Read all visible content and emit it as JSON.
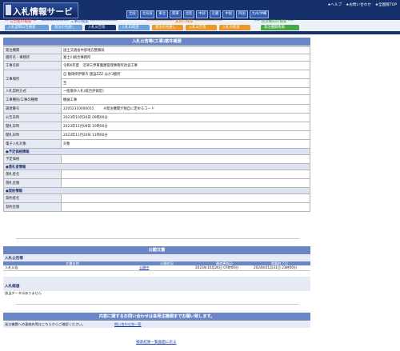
{
  "header": {
    "logo_text": "入札情報サービス",
    "links": [
      "★ヘルプ",
      "★お問い合わせ",
      "★全国版TOP"
    ],
    "regions": [
      "全国",
      "北海道",
      "東北",
      "関東",
      "北陸",
      "中部",
      "近畿",
      "中国",
      "四国",
      "九州/沖縄"
    ]
  },
  "subnav": {
    "items": [
      "** 公告能の検索 **",
      "*************** 工事の検索 ***************",
      "*************** 業務の検索 ***************",
      "*** 発注機関の検索 ***"
    ],
    "colors": [
      "#e23a3a",
      "#3a5fc0",
      "#d97a16",
      "#3c9a3c"
    ]
  },
  "tabs": [
    {
      "label": "入札説明公告検索",
      "color": "#6aa0dc"
    },
    {
      "label": "発注の見通し",
      "color": "#6aa0dc"
    },
    {
      "label": "入札公告等",
      "color": "#15306a"
    },
    {
      "label": "入札の経過",
      "color": "#6aa0dc"
    },
    {
      "label": "発注の見通し",
      "color": "#e79a2c"
    },
    {
      "label": "入札公告等",
      "color": "#e79a2c"
    },
    {
      "label": "入札の経過",
      "color": "#e79a2c"
    },
    {
      "label": "発注機関情報",
      "color": "#4aa84a"
    }
  ],
  "main": {
    "title": "入札公告等(工事)案件概要",
    "rows": [
      {
        "key": "発注機関",
        "value": "国土交通省中部地方整備局"
      },
      {
        "key": "箇所名・事務所",
        "value": "富士川統合事務所"
      },
      {
        "key": "工事名称",
        "value": "令和6年度　沼津三伊東農業管理事務所改良工事"
      },
      {
        "key": "工事場所",
        "value": "自 静岡県伊東市 建設ZZZ ほか3箇所"
      },
      {
        "key": "",
        "value": "至"
      },
      {
        "key": "入札契約方式",
        "value": "一般競争入札(総合評価型)"
      },
      {
        "key": "工事種別/工事の種類",
        "value": "機械工事"
      },
      {
        "key": "調達番号",
        "value": "22052310000015",
        "extra": "※発注機関が独自に定めるコード"
      },
      {
        "key": "公告日時",
        "value": "2023年10月26日 09時00分"
      },
      {
        "key": "開札日時",
        "value": "2023年11月09日 10時00分"
      },
      {
        "key": "開札日時",
        "value": "2023年11月20日 11時00分"
      },
      {
        "key": "電子入札対象",
        "value": "対象"
      }
    ],
    "sections": [
      {
        "title": "●予定価格情報",
        "rows": [
          {
            "key": "予定価格",
            "value": ""
          }
        ]
      },
      {
        "title": "●落札者情報",
        "rows": [
          {
            "key": "落札者名",
            "value": ""
          },
          {
            "key": "落札金額",
            "value": ""
          }
        ]
      },
      {
        "title": "●契約情報",
        "rows": [
          {
            "key": "契約者名",
            "value": ""
          },
          {
            "key": "契約金額",
            "value": ""
          }
        ]
      }
    ]
  },
  "public_docs": {
    "title": "公開文書",
    "notice_heading": "入札公告等",
    "columns": [
      "文書名称",
      "公開状況",
      "最終更新日",
      "掲載終了日"
    ],
    "docs": [
      {
        "name": "入札公告",
        "status": "公開中",
        "updated": "2023年10月26日 07時00分",
        "end": "2024年01月31日 23時00分"
      }
    ],
    "process_heading": "入札経過",
    "process_empty": "該当データはありません"
  },
  "contact": {
    "title": "内容に関するお問い合わせは各発注機関までお願い致します。",
    "text": "発注機関への連絡先等はこちらからご確認ください。",
    "link": "問い合わせ先一覧"
  },
  "footer": {
    "back_link": "検索結果一覧画面に戻る"
  }
}
